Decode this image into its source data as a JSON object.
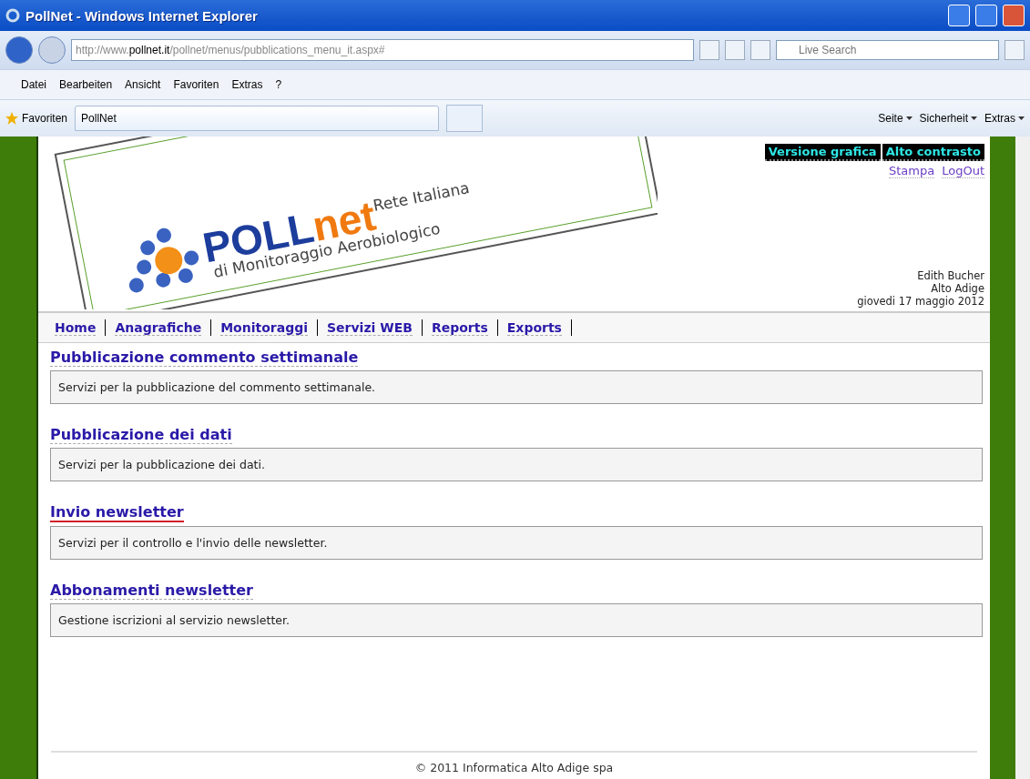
{
  "window": {
    "title": "PollNet - Windows Internet Explorer"
  },
  "address_bar": {
    "url_prefix": "http://www.",
    "url_domain": "pollnet.it",
    "url_path": "/pollnet/menus/pubblications_menu_it.aspx#",
    "search_placeholder": "Live Search"
  },
  "menu_bar": [
    "Datei",
    "Bearbeiten",
    "Ansicht",
    "Favoriten",
    "Extras",
    "?"
  ],
  "favorites_bar": {
    "favorites_label": "Favoriten",
    "tab_title": "PollNet",
    "commands": [
      "Seite",
      "Sicherheit",
      "Extras"
    ]
  },
  "logo": {
    "brand_blue": "POLL",
    "brand_orange": "net",
    "line_1": "Rete Italiana",
    "line_2": "di Monitoraggio Aerobiologico"
  },
  "view_links": [
    {
      "label": "Versione grafica"
    },
    {
      "label": "Alto contrasto"
    }
  ],
  "user_links": [
    "Stampa",
    "LogOut"
  ],
  "user_info": [
    "Edith Bucher",
    "Alto Adige",
    "giovedi 17 maggio 2012"
  ],
  "nav": [
    "Home",
    "Anagrafiche",
    "Monitoraggi",
    "Servizi WEB",
    "Reports",
    "Exports"
  ],
  "sections": [
    {
      "title": "Pubblicazione commento settimanale",
      "description": "Servizi per la pubblicazione del commento settimanale.",
      "selected": false
    },
    {
      "title": "Pubblicazione dei dati",
      "description": "Servizi per la pubblicazione dei dati.",
      "selected": false
    },
    {
      "title": "Invio newsletter",
      "description": "Servizi per il controllo e l'invio delle newsletter.",
      "selected": true
    },
    {
      "title": "Abbonamenti newsletter",
      "description": "Gestione iscrizioni al servizio newsletter.",
      "selected": false
    }
  ],
  "footer": "© 2011 Informatica Alto Adige spa"
}
